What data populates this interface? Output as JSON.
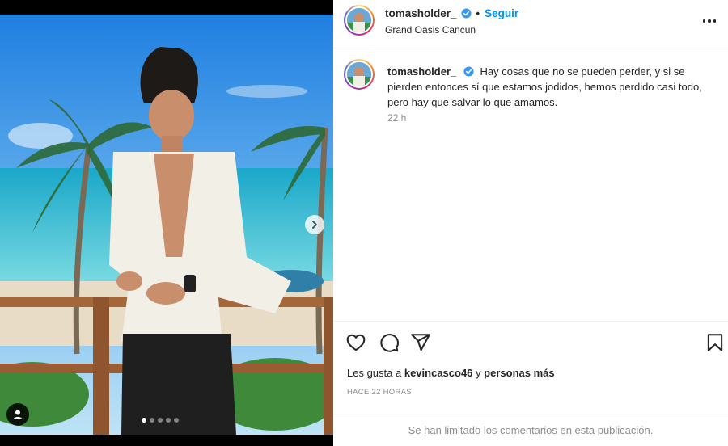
{
  "post": {
    "username": "tomasholder_",
    "follow_label": "Seguir",
    "separator": "•",
    "location": "Grand Oasis Cancun",
    "verified": true,
    "media": {
      "carousel_count": 5,
      "carousel_active_index": 0,
      "icons": {
        "next": "chevron-right-icon",
        "tags": "user-tag-icon"
      }
    }
  },
  "caption": {
    "username": "tomasholder_",
    "text": "Hay cosas que no se pueden perder, y si se pierden entonces sí que estamos jodidos, hemos perdido casi todo, pero hay que salvar lo que amamos.",
    "time": "22 h"
  },
  "actions": {
    "icons": [
      "heart-icon",
      "comment-icon",
      "share-icon",
      "bookmark-icon"
    ]
  },
  "likes": {
    "prefix": "Les gusta a",
    "user": "kevincasco46",
    "connector": "y",
    "others": "personas más"
  },
  "timestamp": "HACE 22 HORAS",
  "comments_notice": "Se han limitado los comentarios en esta publicación.",
  "colors": {
    "accent": "#0095f6",
    "verified": "#3897f0",
    "text": "#262626",
    "muted": "#8e8e8e"
  }
}
